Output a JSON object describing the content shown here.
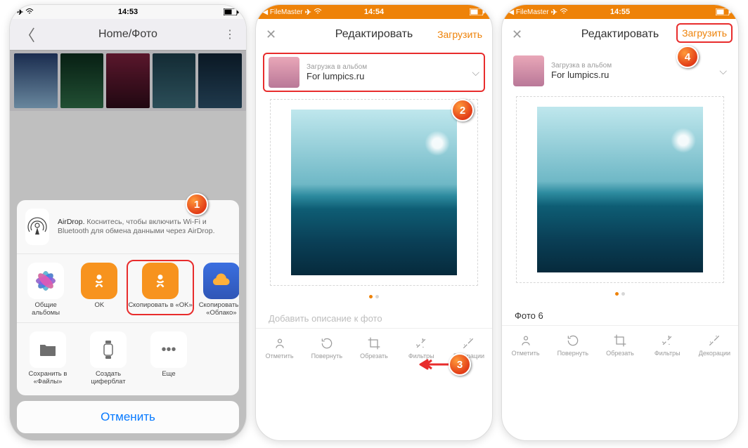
{
  "screen1": {
    "statusbar": {
      "time": "14:53"
    },
    "header": {
      "title": "Home/Фото"
    },
    "airdrop": {
      "bold": "AirDrop.",
      "text": " Коснитесь, чтобы включить Wi-Fi и Bluetooth для обмена данными через AirDrop."
    },
    "apps": [
      {
        "label": "Общие альбомы"
      },
      {
        "label": "OK"
      },
      {
        "label": "Скопировать в «OK»"
      },
      {
        "label": "Скопировать в «Облако»"
      }
    ],
    "actions": [
      {
        "label": "Сохранить в «Файлы»"
      },
      {
        "label": "Создать циферблат"
      },
      {
        "label": "Еще"
      }
    ],
    "cancel": "Отменить"
  },
  "screen2": {
    "statusbar": {
      "app": "FileMaster",
      "time": "14:54"
    },
    "header": {
      "title": "Редактировать",
      "upload": "Загрузить"
    },
    "album": {
      "label": "Загрузка в альбом",
      "name": "For lumpics.ru"
    },
    "caption_placeholder": "Добавить описание к фото",
    "tools": [
      "Отметить",
      "Повернуть",
      "Обрезать",
      "Фильтры",
      "Декорации"
    ]
  },
  "screen3": {
    "statusbar": {
      "app": "FileMaster",
      "time": "14:55"
    },
    "header": {
      "title": "Редактировать",
      "upload": "Загрузить"
    },
    "album": {
      "label": "Загрузка в альбом",
      "name": "For lumpics.ru"
    },
    "caption_value": "Фото 6",
    "tools": [
      "Отметить",
      "Повернуть",
      "Обрезать",
      "Фильтры",
      "Декорации"
    ]
  },
  "badges": {
    "b1": "1",
    "b2": "2",
    "b3": "3",
    "b4": "4"
  }
}
